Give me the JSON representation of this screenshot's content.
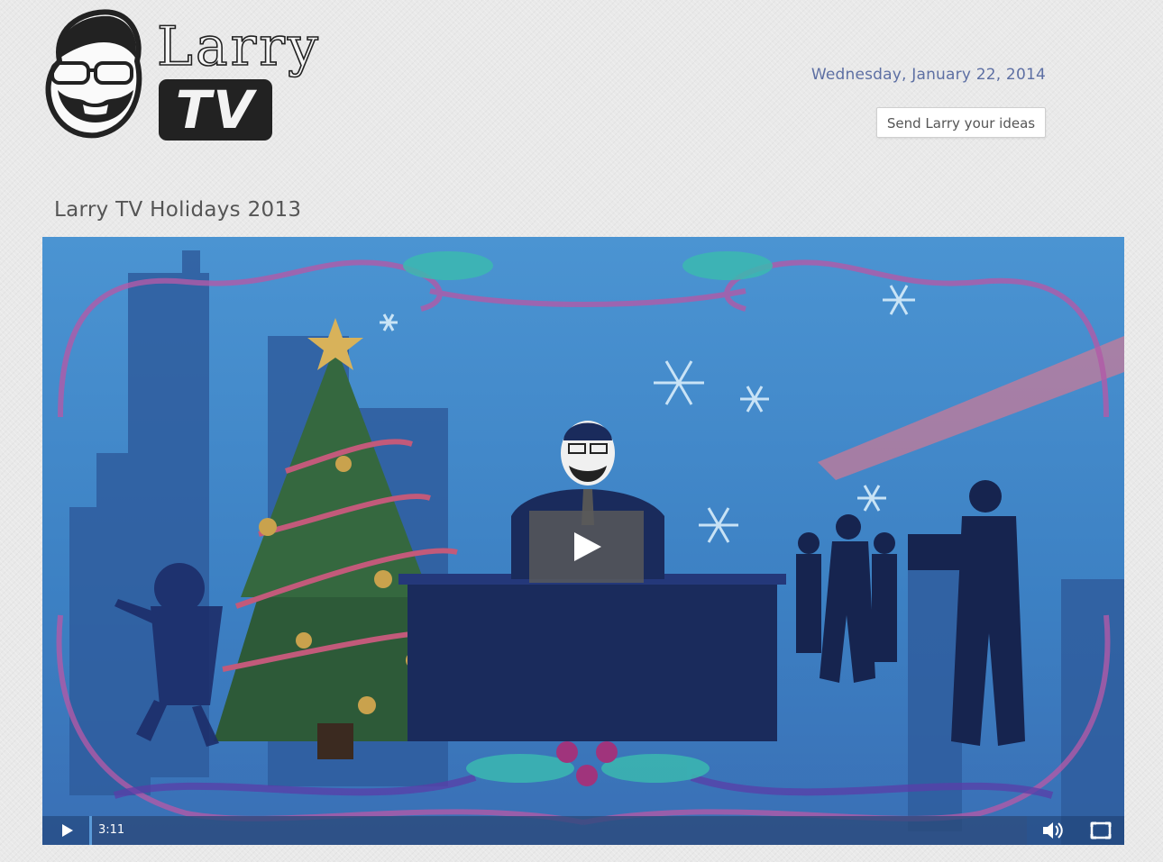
{
  "header": {
    "logo_word": "Larry",
    "logo_tv": "TV",
    "date": "Wednesday, January 22, 2014",
    "ideas_button": "Send Larry your ideas"
  },
  "video": {
    "title": "Larry TV Holidays 2013",
    "duration": "3:11",
    "progress": 0
  },
  "colors": {
    "date_text": "#5d6fa3",
    "video_background": "#3f83c4"
  },
  "icons": {
    "play": "play-icon",
    "volume": "volume-icon",
    "fullscreen": "fullscreen-icon"
  }
}
